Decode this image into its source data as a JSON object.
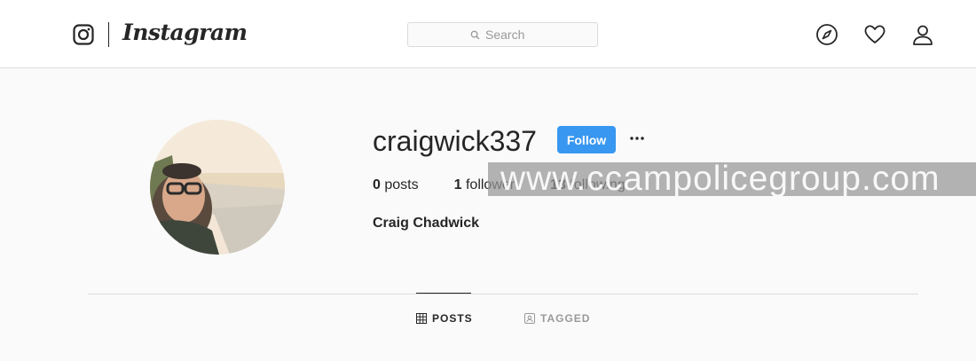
{
  "nav": {
    "logo_icon": "instagram-camera-icon",
    "wordmark": "Instagram",
    "search_placeholder": "Search",
    "icons": [
      "compass-icon",
      "heart-icon",
      "user-icon"
    ]
  },
  "profile": {
    "username": "craigwick337",
    "follow_label": "Follow",
    "more_icon": "ellipsis-icon",
    "stats": {
      "posts_count": "0",
      "posts_label": "posts",
      "followers_count": "1",
      "followers_label": "follower",
      "following_count": "13",
      "following_label": "following"
    },
    "full_name": "Craig Chadwick"
  },
  "watermark": "www.ccampolicegroup.com",
  "tabs": [
    {
      "label": "POSTS",
      "icon": "grid-icon",
      "active": true
    },
    {
      "label": "TAGGED",
      "icon": "tag-portrait-icon",
      "active": false
    }
  ],
  "colors": {
    "accent": "#3897f0",
    "text": "#262626",
    "muted": "#999999",
    "border": "#dbdbdb",
    "background": "#fafafa"
  }
}
